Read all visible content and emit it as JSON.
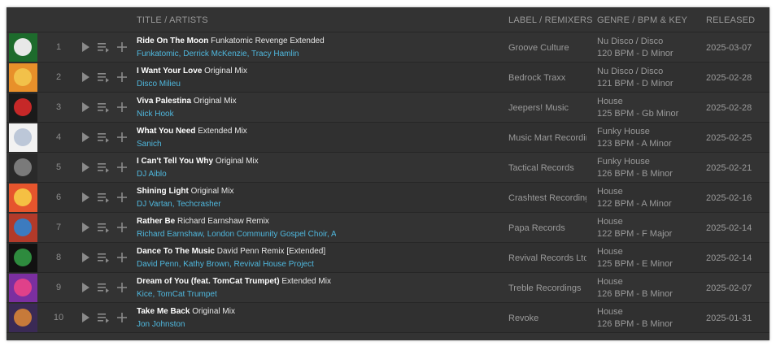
{
  "header": {
    "title_artists": "TITLE / ARTISTS",
    "label_remixers": "LABEL / REMIXERS",
    "genre_bpm_key": "GENRE / BPM & KEY",
    "released": "RELEASED"
  },
  "tracks": [
    {
      "num": "1",
      "title": "Ride On The Moon",
      "mix": "Funkatomic Revenge Extended",
      "artists": "Funkatomic, Derrick McKenzie, Tracy Hamlin",
      "label": "Groove Culture",
      "genre": "Nu Disco / Disco",
      "bpm_key": "120 BPM - D Minor",
      "released": "2025-03-07",
      "art_colors": [
        "#1d6b2c",
        "#e8e8e8"
      ]
    },
    {
      "num": "2",
      "title": "I Want Your Love",
      "mix": "Original Mix",
      "artists": "Disco Milieu",
      "label": "Bedrock Traxx",
      "genre": "Nu Disco / Disco",
      "bpm_key": "121 BPM - D Minor",
      "released": "2025-02-28",
      "art_colors": [
        "#e8902a",
        "#f2c14a"
      ]
    },
    {
      "num": "3",
      "title": "Viva Palestina",
      "mix": "Original Mix",
      "artists": "Nick Hook",
      "label": "Jeepers! Music",
      "genre": "House",
      "bpm_key": "125 BPM - Gb Minor",
      "released": "2025-02-28",
      "art_colors": [
        "#1a1a1a",
        "#c62828"
      ]
    },
    {
      "num": "4",
      "title": "What You Need",
      "mix": "Extended Mix",
      "artists": "Sanich",
      "label": "Music Mart Recordings",
      "genre": "Funky House",
      "bpm_key": "123 BPM - A Minor",
      "released": "2025-02-25",
      "art_colors": [
        "#f2f2f2",
        "#bcc7d8"
      ]
    },
    {
      "num": "5",
      "title": "I Can't Tell You Why",
      "mix": "Original Mix",
      "artists": "DJ Aiblo",
      "label": "Tactical Records",
      "genre": "Funky House",
      "bpm_key": "126 BPM - B Minor",
      "released": "2025-02-21",
      "art_colors": [
        "#2a2a2a",
        "#7a7a7a"
      ]
    },
    {
      "num": "6",
      "title": "Shining Light",
      "mix": "Original Mix",
      "artists": "DJ Vartan, Techcrasher",
      "label": "Crashtest Recordings",
      "genre": "House",
      "bpm_key": "122 BPM - A Minor",
      "released": "2025-02-16",
      "art_colors": [
        "#e6552d",
        "#f5c043"
      ]
    },
    {
      "num": "7",
      "title": "Rather Be",
      "mix": "Richard Earnshaw Remix",
      "artists": "Richard Earnshaw, London Community Gospel Choir, Asha Elia",
      "label": "Papa Records",
      "genre": "House",
      "bpm_key": "122 BPM - F Major",
      "released": "2025-02-14",
      "art_colors": [
        "#b23a2a",
        "#3c7bbf"
      ]
    },
    {
      "num": "8",
      "title": "Dance To The Music",
      "mix": "David Penn Remix [Extended]",
      "artists": "David Penn, Kathy Brown, Revival House Project",
      "label": "Revival Records Ltd",
      "genre": "House",
      "bpm_key": "125 BPM - E Minor",
      "released": "2025-02-14",
      "art_colors": [
        "#111111",
        "#2e8b3e"
      ]
    },
    {
      "num": "9",
      "title": "Dream of You (feat. TomCat Trumpet)",
      "mix": "Extended Mix",
      "artists": "Kice, TomCat Trumpet",
      "label": "Treble Recordings",
      "genre": "House",
      "bpm_key": "126 BPM - B Minor",
      "released": "2025-02-07",
      "art_colors": [
        "#7b2fa0",
        "#e0418a"
      ]
    },
    {
      "num": "10",
      "title": "Take Me Back",
      "mix": "Original Mix",
      "artists": "Jon Johnston",
      "label": "Revoke",
      "genre": "House",
      "bpm_key": "126 BPM - B Minor",
      "released": "2025-01-31",
      "art_colors": [
        "#3a2a55",
        "#c77a3a"
      ]
    }
  ],
  "icons": {
    "play": "play-icon",
    "queue": "add-to-queue-icon",
    "add": "add-to-playlist-icon"
  }
}
